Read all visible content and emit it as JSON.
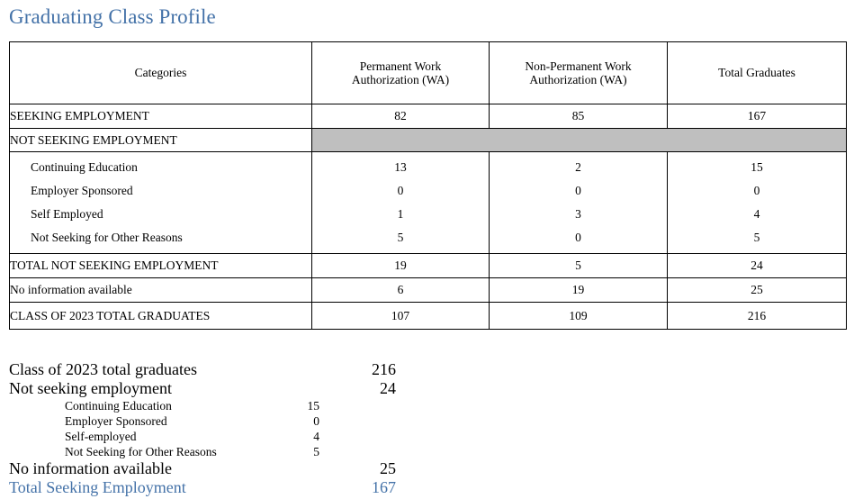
{
  "page": {
    "title": "Graduating Class Profile",
    "accent_color": "#4472a8",
    "shade_color": "#bfbfbf"
  },
  "table": {
    "columns": [
      {
        "key": "categories",
        "label": "Categories",
        "line1": "Categories",
        "line2": ""
      },
      {
        "key": "permanent_wa",
        "label": "Permanent Work Authorization (WA)",
        "line1": "Permanent Work",
        "line2": "Authorization (WA)"
      },
      {
        "key": "non_permanent_wa",
        "label": "Non-Permanent Work Authorization (WA)",
        "line1": "Non-Permanent Work",
        "line2": "Authorization (WA)"
      },
      {
        "key": "total_graduates",
        "label": "Total Graduates",
        "line1": "",
        "line2": "Total Graduates"
      }
    ],
    "rows": {
      "seeking_employment": {
        "label": "SEEKING EMPLOYMENT",
        "permanent_wa": "82",
        "non_permanent_wa": "85",
        "total_graduates": "167"
      },
      "not_seeking_employment_header": {
        "label": "NOT SEEKING EMPLOYMENT",
        "shaded": "true"
      },
      "sub_items": [
        {
          "label": "Continuing Education",
          "permanent_wa": "13",
          "non_permanent_wa": "2",
          "total_graduates": "15"
        },
        {
          "label": "Employer Sponsored",
          "permanent_wa": "0",
          "non_permanent_wa": "0",
          "total_graduates": "0"
        },
        {
          "label": "Self Employed",
          "permanent_wa": "1",
          "non_permanent_wa": "3",
          "total_graduates": "4"
        },
        {
          "label": "Not Seeking for Other Reasons",
          "permanent_wa": "5",
          "non_permanent_wa": "0",
          "total_graduates": "5"
        }
      ],
      "total_not_seeking": {
        "label": "TOTAL NOT SEEKING EMPLOYMENT",
        "permanent_wa": "19",
        "non_permanent_wa": "5",
        "total_graduates": "24"
      },
      "no_information": {
        "label": "No information available",
        "permanent_wa": "6",
        "non_permanent_wa": "19",
        "total_graduates": "25"
      },
      "class_total": {
        "label": "CLASS OF 2023 TOTAL GRADUATES",
        "permanent_wa": "107",
        "non_permanent_wa": "109",
        "total_graduates": "216"
      }
    }
  },
  "summary": {
    "rows": [
      {
        "label": "Class of 2023 total graduates",
        "value": "216"
      },
      {
        "label": "Not seeking employment",
        "value": "24"
      }
    ],
    "sub_rows": [
      {
        "label": "Continuing Education",
        "value": "15"
      },
      {
        "label": "Employer Sponsored",
        "value": "0"
      },
      {
        "label": "Self-employed",
        "value": "4"
      },
      {
        "label": "Not Seeking for Other Reasons",
        "value": "5"
      }
    ],
    "no_information": {
      "label": "No information available",
      "value": "25"
    },
    "total_seeking": {
      "label": "Total Seeking Employment",
      "value": "167"
    }
  }
}
